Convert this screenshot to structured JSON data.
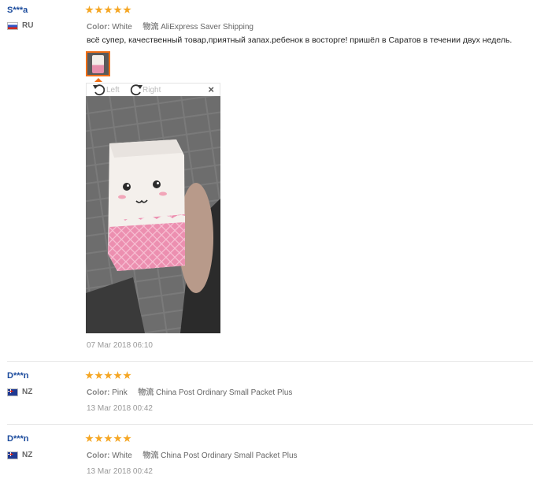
{
  "reviews": [
    {
      "user": "S***a",
      "country": "RU",
      "rating": 5,
      "color_label": "Color:",
      "color_value": "White",
      "shipping_label": "物流",
      "shipping_value": "AliExpress Saver Shipping",
      "text": "всё супер, качественный товар,приятный запах.ребенок в восторге! пришёл в Саратов в течении двух недель.",
      "date": "07 Mar 2018 06:10"
    },
    {
      "user": "D***n",
      "country": "NZ",
      "rating": 5,
      "color_label": "Color:",
      "color_value": "Pink",
      "shipping_label": "物流",
      "shipping_value": "China Post Ordinary Small Packet Plus",
      "date": "13 Mar 2018 00:42"
    },
    {
      "user": "D***n",
      "country": "NZ",
      "rating": 5,
      "color_label": "Color:",
      "color_value": "White",
      "shipping_label": "物流",
      "shipping_value": "China Post Ordinary Small Packet Plus",
      "date": "13 Mar 2018 00:42"
    }
  ],
  "viewer": {
    "rotate_left": "Left",
    "rotate_right": "Right",
    "close": "×"
  },
  "colors": {
    "star": "#f5a623",
    "accent": "#f06e16",
    "username": "#1a4a9c"
  },
  "icons": [
    "star-icon",
    "rotate-left-icon",
    "rotate-right-icon",
    "close-icon",
    "flag-ru-icon",
    "flag-nz-icon"
  ]
}
